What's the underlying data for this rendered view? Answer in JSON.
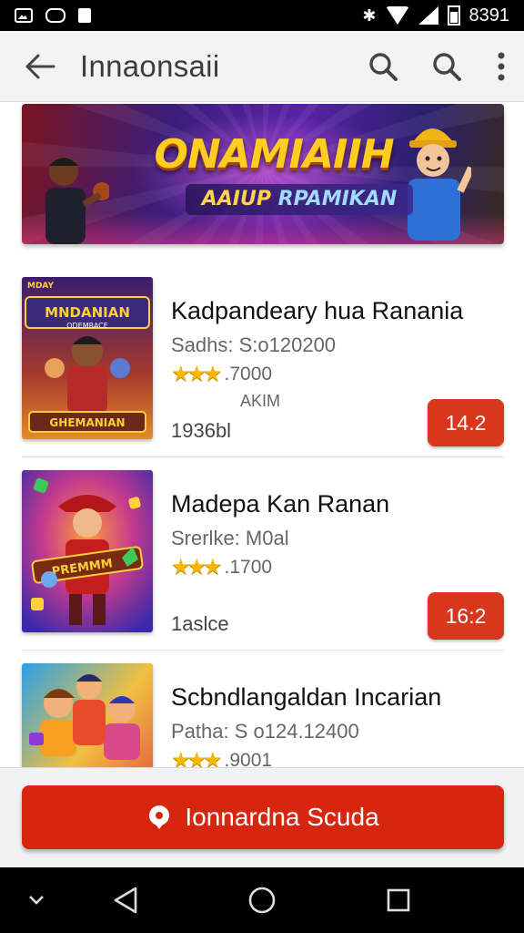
{
  "status_bar": {
    "time": "8391",
    "icons": [
      "image-icon",
      "gamepad-icon",
      "document-icon",
      "bluetooth-icon",
      "wifi-icon",
      "signal-icon",
      "battery-icon"
    ]
  },
  "app_bar": {
    "title": "Innaonsaii",
    "icons": [
      "back-arrow-icon",
      "search-icon",
      "search-icon",
      "more-vert-icon"
    ]
  },
  "banner": {
    "title": "ONAMIAIIH",
    "subtitle_part1": "AAIUP",
    "subtitle_part2": "RPAMIKAN"
  },
  "games": [
    {
      "thumb_top": "MNDANIAN",
      "thumb_sub": "ODEMRACE",
      "thumb_bottom": "GHEMANIAN",
      "thumb_badge": "MDAY",
      "title": "Kadpandeary hua Ranania",
      "subtitle": "Sadhs: S:o120200",
      "rating_text": ".7000",
      "extra": "AKIM",
      "count": "1936bl",
      "price": "14.2"
    },
    {
      "thumb_top": "",
      "thumb_sub": "",
      "thumb_bottom": "PREMMM",
      "thumb_badge": "",
      "title": "Madepa Kan Ranan",
      "subtitle": "Srerlke: M0al",
      "rating_text": ".1700",
      "extra": "",
      "count": "1aslce",
      "price": "16:2"
    },
    {
      "thumb_top": "",
      "thumb_sub": "",
      "thumb_bottom": "",
      "thumb_badge": "",
      "title": "Scbndlangaldan Incarian",
      "subtitle": "Patha: S o124.12400",
      "rating_text": ".9001",
      "extra": "",
      "count": "",
      "price": ""
    }
  ],
  "bottom_button": {
    "label": "Ionnardna Scuda",
    "icon": "location-pin-icon"
  },
  "nav_bar": {
    "icons": [
      "chevron-down-icon",
      "back-triangle-icon",
      "home-circle-icon",
      "recents-square-icon"
    ]
  },
  "colors": {
    "accent": "#d7250f",
    "price_button": "#d9361e",
    "star": "#f5b700"
  }
}
